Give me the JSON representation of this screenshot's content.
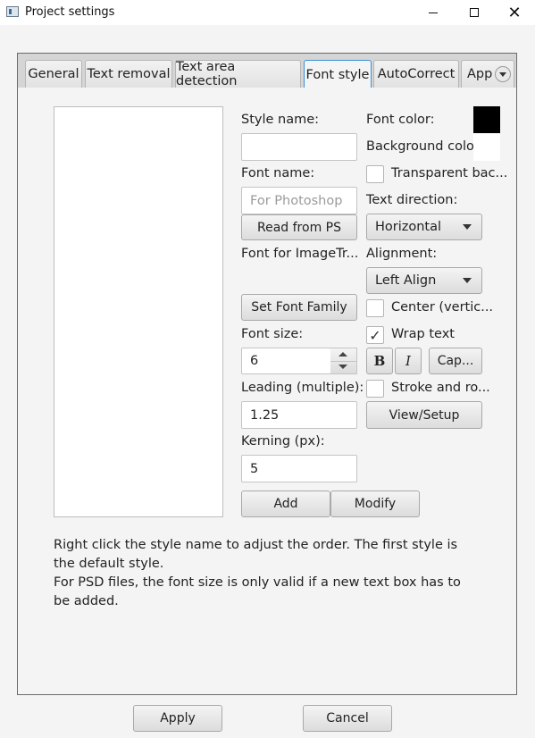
{
  "window": {
    "title": "Project settings",
    "minimize_icon": "minimize-icon",
    "maximize_icon": "maximize-icon",
    "close_glyph": "✕"
  },
  "tabs": [
    {
      "label": "General",
      "selected": false
    },
    {
      "label": "Text removal",
      "selected": false
    },
    {
      "label": "Text area detection",
      "selected": false
    },
    {
      "label": "Font style",
      "selected": true
    },
    {
      "label": "AutoCorrect",
      "selected": false
    },
    {
      "label": "App",
      "selected": false
    }
  ],
  "font_style": {
    "style_name_label": "Style name:",
    "style_name_value": "",
    "font_name_label": "Font name:",
    "font_name_placeholder": "For Photoshop",
    "read_from_ps_label": "Read from PS",
    "font_for_imagetr_label": "Font for ImageTr...",
    "set_font_family_label": "Set Font Family",
    "font_size_label": "Font size:",
    "font_size_value": "6",
    "leading_label": "Leading (multiple):",
    "leading_value": "1.25",
    "kerning_label": "Kerning (px):",
    "kerning_value": "5",
    "add_label": "Add",
    "modify_label": "Modify",
    "font_color_label": "Font color:",
    "font_color": "#000000",
    "background_color_label": "Background color:",
    "background_color": "#ffffff",
    "transparent_label": "Transparent bac...",
    "transparent_checked": false,
    "text_direction_label": "Text direction:",
    "text_direction_value": "Horizontal",
    "alignment_label": "Alignment:",
    "alignment_value": "Left Align",
    "center_label": "Center (vertic...",
    "center_checked": false,
    "wrap_text_label": "Wrap text",
    "wrap_text_checked": true,
    "bold_label": "B",
    "italic_label": "I",
    "cap_label": "Cap...",
    "stroke_label": "Stroke and ro...",
    "stroke_checked": false,
    "view_setup_label": "View/Setup"
  },
  "info": {
    "line1": "Right click the style name to adjust the order. The first style is the default style.",
    "line2": "For PSD files, the font size is only valid if a new text box has to be added."
  },
  "footer": {
    "apply_label": "Apply",
    "cancel_label": "Cancel"
  },
  "colors": {
    "selected_tab_border": "#3b8fd7"
  }
}
